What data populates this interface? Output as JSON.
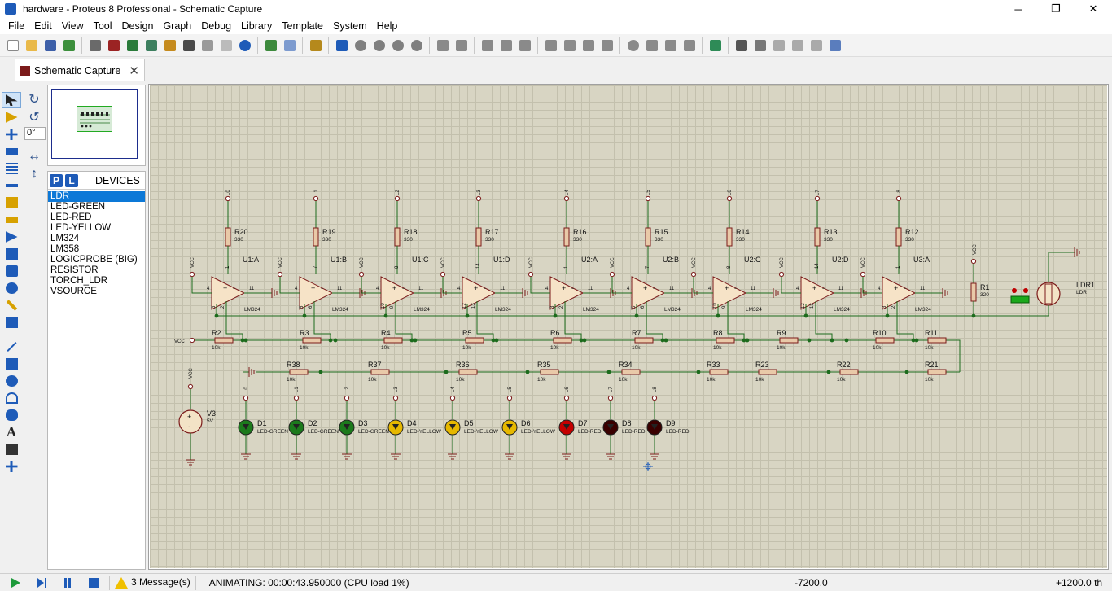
{
  "window": {
    "title": "hardware - Proteus 8 Professional - Schematic Capture",
    "minimize": "─",
    "maximize": "❐",
    "close": "✕"
  },
  "menu": [
    "File",
    "Edit",
    "View",
    "Tool",
    "Design",
    "Graph",
    "Debug",
    "Library",
    "Template",
    "System",
    "Help"
  ],
  "tab": {
    "label": "Schematic Capture",
    "close": "✕"
  },
  "rotation": {
    "angle": "0°"
  },
  "devices": {
    "header": "DEVICES",
    "p_label": "P",
    "l_label": "L",
    "items": [
      "LDR",
      "LED-GREEN",
      "LED-RED",
      "LED-YELLOW",
      "LM324",
      "LM358",
      "LOGICPROBE (BIG)",
      "RESISTOR",
      "TORCH_LDR",
      "VSOURCE"
    ],
    "selected": "LDR"
  },
  "schematic": {
    "opamps": [
      {
        "ref": "U1:A",
        "rtop": "R20",
        "net": "L0",
        "pins": [
          "3",
          "2",
          "1",
          "4",
          "11"
        ]
      },
      {
        "ref": "U1:B",
        "rtop": "R19",
        "net": "L1",
        "pins": [
          "5",
          "6",
          "7",
          "4",
          "11"
        ]
      },
      {
        "ref": "U1:C",
        "rtop": "R18",
        "net": "L2",
        "pins": [
          "10",
          "9",
          "8",
          "4",
          "11"
        ]
      },
      {
        "ref": "U1:D",
        "rtop": "R17",
        "net": "L3",
        "pins": [
          "12",
          "13",
          "14",
          "4",
          "11"
        ]
      },
      {
        "ref": "U2:A",
        "rtop": "R16",
        "net": "L4",
        "pins": [
          "3",
          "2",
          "1",
          "4",
          "11"
        ]
      },
      {
        "ref": "U2:B",
        "rtop": "R15",
        "net": "L5",
        "pins": [
          "5",
          "6",
          "7",
          "4",
          "11"
        ]
      },
      {
        "ref": "U2:C",
        "rtop": "R14",
        "net": "L6",
        "pins": [
          "10",
          "9",
          "8",
          "4",
          "11"
        ]
      },
      {
        "ref": "U2:D",
        "rtop": "R13",
        "net": "L7",
        "pins": [
          "12",
          "13",
          "14",
          "4",
          "11"
        ]
      },
      {
        "ref": "U3:A",
        "rtop": "R12",
        "net": "L8",
        "pins": [
          "3",
          "2",
          "1",
          "4",
          "11"
        ]
      }
    ],
    "opamp_part": "LM324",
    "rtop_value": "330",
    "vcc": "VCC",
    "divider1": [
      "R2",
      "R3",
      "R4",
      "R5",
      "R6",
      "R7",
      "R8",
      "R9",
      "R10",
      "R11"
    ],
    "divider2": [
      "R38",
      "R37",
      "R36",
      "R35",
      "R34",
      "R33",
      "R23",
      "R22",
      "R21"
    ],
    "rdiv_value": "10k",
    "r1": {
      "ref": "R1",
      "value": "320"
    },
    "ldr": {
      "ref": "LDR1",
      "part": "LDR"
    },
    "vsrc": {
      "ref": "V3",
      "value": "5V"
    },
    "leds": [
      {
        "ref": "D1",
        "part": "LED-GREEN",
        "net": "L0",
        "color": "#1c7a1c"
      },
      {
        "ref": "D2",
        "part": "LED-GREEN",
        "net": "L1",
        "color": "#1c7a1c"
      },
      {
        "ref": "D3",
        "part": "LED-GREEN",
        "net": "L2",
        "color": "#1c7a1c"
      },
      {
        "ref": "D4",
        "part": "LED-YELLOW",
        "net": "L3",
        "color": "#e6b800"
      },
      {
        "ref": "D5",
        "part": "LED-YELLOW",
        "net": "L4",
        "color": "#e6b800"
      },
      {
        "ref": "D6",
        "part": "LED-YELLOW",
        "net": "L5",
        "color": "#e6b800"
      },
      {
        "ref": "D7",
        "part": "LED-RED",
        "net": "L6",
        "color": "#c40000"
      },
      {
        "ref": "D8",
        "part": "LED-RED",
        "net": "L7",
        "color": "#3a0000"
      },
      {
        "ref": "D9",
        "part": "LED-RED",
        "net": "L8",
        "color": "#3a0000"
      }
    ],
    "colors": {
      "wire": "#1c6b1c",
      "part": "#7b1a1a",
      "resistor_fill": "#e9c9a8"
    }
  },
  "status": {
    "messages": "3 Message(s)",
    "animating": "ANIMATING: 00:00:43.950000 (CPU load 1%)",
    "coord_x": "-7200.0",
    "coord_y": "+1200.0",
    "unit": "th"
  }
}
